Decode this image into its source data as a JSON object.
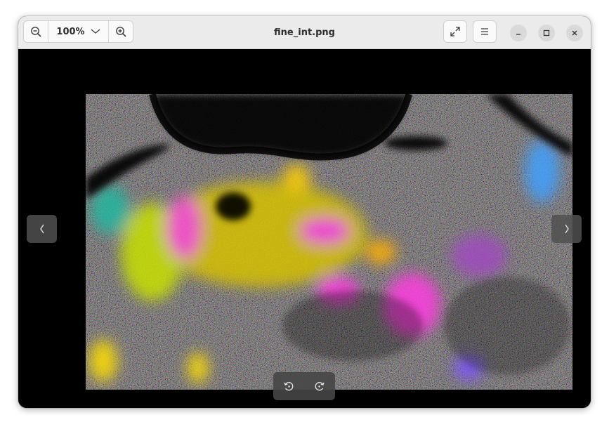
{
  "window": {
    "title": "fine_int.png"
  },
  "toolbar": {
    "zoom_level": "100%",
    "zoom_out_icon": "zoom-out-icon",
    "zoom_in_icon": "zoom-in-icon",
    "zoom_menu_icon": "chevron-down-icon",
    "fullscreen_icon": "fullscreen-icon",
    "menu_icon": "hamburger-menu-icon"
  },
  "window_controls": {
    "minimize_icon": "minimize-icon",
    "maximize_icon": "maximize-icon",
    "close_icon": "close-icon"
  },
  "viewer": {
    "image_description_icon": "sar-interferogram-image",
    "prev_icon": "chevron-left-icon",
    "next_icon": "chevron-right-icon",
    "rotate_left_icon": "rotate-left-icon",
    "rotate_right_icon": "rotate-right-icon"
  },
  "colors": {
    "headerbar": "#ebebeb",
    "background": "#000000",
    "overlay_button": "#505050"
  }
}
